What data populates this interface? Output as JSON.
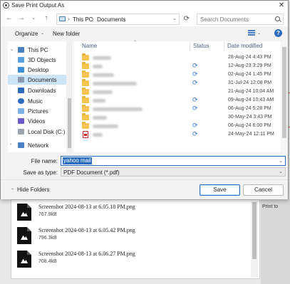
{
  "dialog": {
    "title": "Save Print Output As",
    "close_glyph": "✕"
  },
  "nav": {
    "back_glyph": "←",
    "forward_glyph": "→",
    "up_glyph": "↑",
    "dropdown_glyph": "⌄",
    "breadcrumb": [
      "This PC",
      "Documents"
    ],
    "breadcrumb_sep": "›",
    "refresh_glyph": "⟳",
    "search_placeholder": "Search Documents"
  },
  "toolbar": {
    "organize_label": "Organize",
    "new_folder_label": "New folder",
    "help_glyph": "?"
  },
  "sidebar": {
    "items": [
      {
        "label": "This PC",
        "icon": "pc-icon",
        "color": "#4a7fc1"
      },
      {
        "label": "3D Objects",
        "icon": "cube-icon",
        "color": "#5aa0e0"
      },
      {
        "label": "Desktop",
        "icon": "desktop-icon",
        "color": "#3b8fd9"
      },
      {
        "label": "Documents",
        "icon": "documents-icon",
        "color": "#8a9bb0"
      },
      {
        "label": "Downloads",
        "icon": "download-icon",
        "color": "#2b6cbf"
      },
      {
        "label": "Music",
        "icon": "music-icon",
        "color": "#2b6cbf"
      },
      {
        "label": "Pictures",
        "icon": "pictures-icon",
        "color": "#7fb2e5"
      },
      {
        "label": "Videos",
        "icon": "videos-icon",
        "color": "#6a5acd"
      },
      {
        "label": "Local Disk (C:)",
        "icon": "disk-icon",
        "color": "#9aa5b1"
      },
      {
        "label": "Network",
        "icon": "network-icon",
        "color": "#4a7fc1"
      }
    ],
    "selected_index": 3
  },
  "filelist": {
    "columns": {
      "name": "Name",
      "status": "Status",
      "date": "Date modified"
    },
    "rows": [
      {
        "type": "folder",
        "sync": false,
        "date": "28-Aug-24 4:43 PM"
      },
      {
        "type": "folder",
        "sync": true,
        "date": "12-Aug-23 3:29 PM"
      },
      {
        "type": "folder",
        "sync": true,
        "date": "02-Aug-24 1:45 PM"
      },
      {
        "type": "folder",
        "sync": true,
        "date": "31-Jul-24 12:08 PM"
      },
      {
        "type": "folder",
        "sync": false,
        "date": "21-Aug-24 10:04 AM"
      },
      {
        "type": "folder",
        "sync": true,
        "date": "09-Aug-24 10:43 AM"
      },
      {
        "type": "folder",
        "sync": true,
        "date": "06-Aug-24 5:28 PM"
      },
      {
        "type": "folder",
        "sync": false,
        "date": "30-May-24 3:43 PM"
      },
      {
        "type": "folder",
        "sync": true,
        "date": "06-Aug-24 6:00 PM"
      },
      {
        "type": "pdf",
        "sync": true,
        "date": "24-May-24 12:11 PM"
      }
    ]
  },
  "form": {
    "file_name_label": "File name:",
    "file_name_value": "yahoo mail",
    "save_type_label": "Save as type:",
    "save_type_value": "PDF Document (*.pdf)"
  },
  "footer": {
    "hide_folders_label": "Hide Folders",
    "save_label": "Save",
    "cancel_label": "Cancel"
  },
  "background": {
    "files": [
      {
        "name": "Screenshot 2024-08-13 at 6.05.18 PM.png",
        "size": "767.9kB"
      },
      {
        "name": "Screenshot 2024-08-13 at 6.05.42 PM.png",
        "size": "796.3kB"
      },
      {
        "name": "Screenshot 2024-08-13 at 6.06.27 PM.png",
        "size": "708.4kB"
      }
    ],
    "side_text": "Print to"
  }
}
